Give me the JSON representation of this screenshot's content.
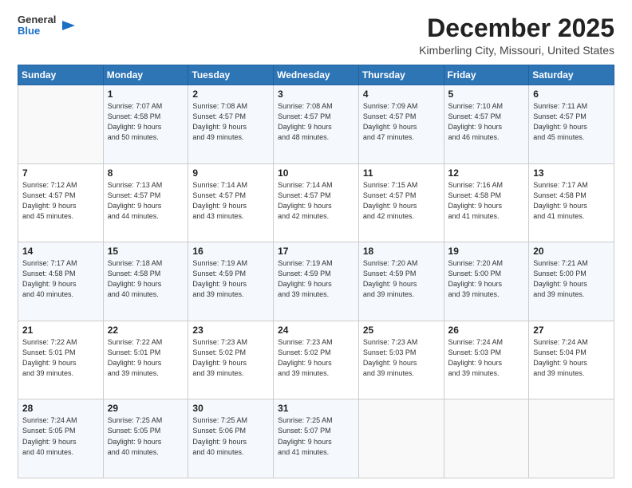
{
  "logo": {
    "general": "General",
    "blue": "Blue"
  },
  "title": "December 2025",
  "location": "Kimberling City, Missouri, United States",
  "weekdays": [
    "Sunday",
    "Monday",
    "Tuesday",
    "Wednesday",
    "Thursday",
    "Friday",
    "Saturday"
  ],
  "weeks": [
    [
      {
        "day": "",
        "info": ""
      },
      {
        "day": "1",
        "info": "Sunrise: 7:07 AM\nSunset: 4:58 PM\nDaylight: 9 hours\nand 50 minutes."
      },
      {
        "day": "2",
        "info": "Sunrise: 7:08 AM\nSunset: 4:57 PM\nDaylight: 9 hours\nand 49 minutes."
      },
      {
        "day": "3",
        "info": "Sunrise: 7:08 AM\nSunset: 4:57 PM\nDaylight: 9 hours\nand 48 minutes."
      },
      {
        "day": "4",
        "info": "Sunrise: 7:09 AM\nSunset: 4:57 PM\nDaylight: 9 hours\nand 47 minutes."
      },
      {
        "day": "5",
        "info": "Sunrise: 7:10 AM\nSunset: 4:57 PM\nDaylight: 9 hours\nand 46 minutes."
      },
      {
        "day": "6",
        "info": "Sunrise: 7:11 AM\nSunset: 4:57 PM\nDaylight: 9 hours\nand 45 minutes."
      }
    ],
    [
      {
        "day": "7",
        "info": "Sunrise: 7:12 AM\nSunset: 4:57 PM\nDaylight: 9 hours\nand 45 minutes."
      },
      {
        "day": "8",
        "info": "Sunrise: 7:13 AM\nSunset: 4:57 PM\nDaylight: 9 hours\nand 44 minutes."
      },
      {
        "day": "9",
        "info": "Sunrise: 7:14 AM\nSunset: 4:57 PM\nDaylight: 9 hours\nand 43 minutes."
      },
      {
        "day": "10",
        "info": "Sunrise: 7:14 AM\nSunset: 4:57 PM\nDaylight: 9 hours\nand 42 minutes."
      },
      {
        "day": "11",
        "info": "Sunrise: 7:15 AM\nSunset: 4:57 PM\nDaylight: 9 hours\nand 42 minutes."
      },
      {
        "day": "12",
        "info": "Sunrise: 7:16 AM\nSunset: 4:58 PM\nDaylight: 9 hours\nand 41 minutes."
      },
      {
        "day": "13",
        "info": "Sunrise: 7:17 AM\nSunset: 4:58 PM\nDaylight: 9 hours\nand 41 minutes."
      }
    ],
    [
      {
        "day": "14",
        "info": "Sunrise: 7:17 AM\nSunset: 4:58 PM\nDaylight: 9 hours\nand 40 minutes."
      },
      {
        "day": "15",
        "info": "Sunrise: 7:18 AM\nSunset: 4:58 PM\nDaylight: 9 hours\nand 40 minutes."
      },
      {
        "day": "16",
        "info": "Sunrise: 7:19 AM\nSunset: 4:59 PM\nDaylight: 9 hours\nand 39 minutes."
      },
      {
        "day": "17",
        "info": "Sunrise: 7:19 AM\nSunset: 4:59 PM\nDaylight: 9 hours\nand 39 minutes."
      },
      {
        "day": "18",
        "info": "Sunrise: 7:20 AM\nSunset: 4:59 PM\nDaylight: 9 hours\nand 39 minutes."
      },
      {
        "day": "19",
        "info": "Sunrise: 7:20 AM\nSunset: 5:00 PM\nDaylight: 9 hours\nand 39 minutes."
      },
      {
        "day": "20",
        "info": "Sunrise: 7:21 AM\nSunset: 5:00 PM\nDaylight: 9 hours\nand 39 minutes."
      }
    ],
    [
      {
        "day": "21",
        "info": "Sunrise: 7:22 AM\nSunset: 5:01 PM\nDaylight: 9 hours\nand 39 minutes."
      },
      {
        "day": "22",
        "info": "Sunrise: 7:22 AM\nSunset: 5:01 PM\nDaylight: 9 hours\nand 39 minutes."
      },
      {
        "day": "23",
        "info": "Sunrise: 7:23 AM\nSunset: 5:02 PM\nDaylight: 9 hours\nand 39 minutes."
      },
      {
        "day": "24",
        "info": "Sunrise: 7:23 AM\nSunset: 5:02 PM\nDaylight: 9 hours\nand 39 minutes."
      },
      {
        "day": "25",
        "info": "Sunrise: 7:23 AM\nSunset: 5:03 PM\nDaylight: 9 hours\nand 39 minutes."
      },
      {
        "day": "26",
        "info": "Sunrise: 7:24 AM\nSunset: 5:03 PM\nDaylight: 9 hours\nand 39 minutes."
      },
      {
        "day": "27",
        "info": "Sunrise: 7:24 AM\nSunset: 5:04 PM\nDaylight: 9 hours\nand 39 minutes."
      }
    ],
    [
      {
        "day": "28",
        "info": "Sunrise: 7:24 AM\nSunset: 5:05 PM\nDaylight: 9 hours\nand 40 minutes."
      },
      {
        "day": "29",
        "info": "Sunrise: 7:25 AM\nSunset: 5:05 PM\nDaylight: 9 hours\nand 40 minutes."
      },
      {
        "day": "30",
        "info": "Sunrise: 7:25 AM\nSunset: 5:06 PM\nDaylight: 9 hours\nand 40 minutes."
      },
      {
        "day": "31",
        "info": "Sunrise: 7:25 AM\nSunset: 5:07 PM\nDaylight: 9 hours\nand 41 minutes."
      },
      {
        "day": "",
        "info": ""
      },
      {
        "day": "",
        "info": ""
      },
      {
        "day": "",
        "info": ""
      }
    ]
  ]
}
